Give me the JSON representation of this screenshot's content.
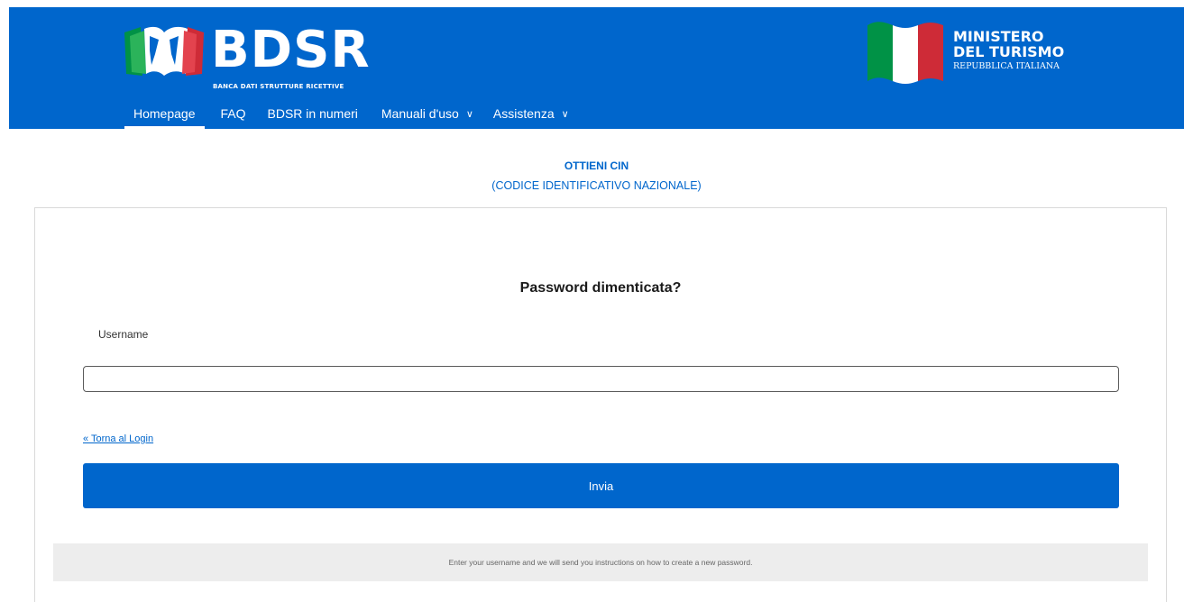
{
  "header": {
    "brand": "BDSR",
    "tagline": "BANCA DATI STRUTTURE RICETTIVE",
    "ministry_line1": "MINISTERO",
    "ministry_line2": "DEL TURISMO",
    "ministry_line3": "REPUBBLICA ITALIANA",
    "nav": {
      "homepage": "Homepage",
      "faq": "FAQ",
      "numbers": "BDSR in numeri",
      "manuals": "Manuali d'uso",
      "support": "Assistenza"
    }
  },
  "page": {
    "title": "OTTIENI CIN",
    "subtitle": "(CODICE IDENTIFICATIVO NAZIONALE)"
  },
  "form": {
    "heading": "Password dimenticata?",
    "username_label": "Username",
    "username_value": "",
    "back_link": "« Torna al Login",
    "submit_label": "Invia",
    "info_text": "Enter your username and we will send you instructions on how to create a new password."
  },
  "colors": {
    "primary": "#0066cc",
    "flag_green": "#009246",
    "flag_white": "#ffffff",
    "flag_red": "#ce2b37"
  }
}
